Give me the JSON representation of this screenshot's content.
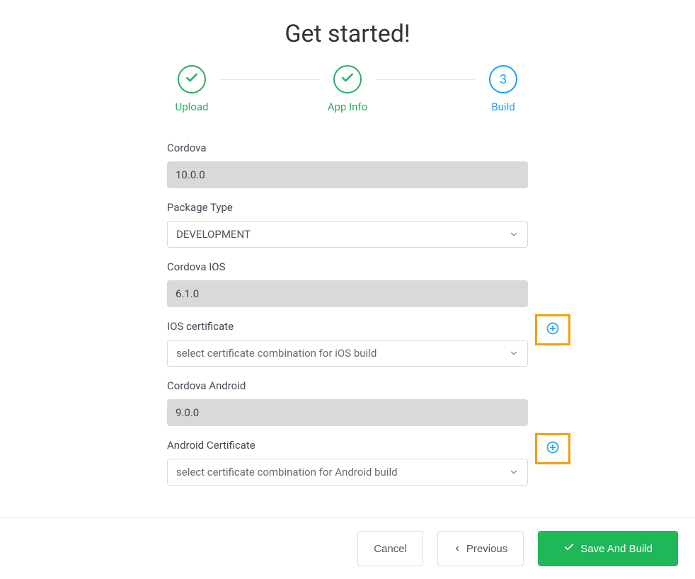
{
  "title": "Get started!",
  "steps": [
    {
      "label": "Upload",
      "state": "done"
    },
    {
      "label": "App Info",
      "state": "done"
    },
    {
      "label": "Build",
      "state": "active",
      "number": "3"
    }
  ],
  "form": {
    "cordova": {
      "label": "Cordova",
      "value": "10.0.0"
    },
    "package_type": {
      "label": "Package Type",
      "value": "DEVELOPMENT"
    },
    "cordova_ios": {
      "label": "Cordova IOS",
      "value": "6.1.0"
    },
    "ios_cert": {
      "label": "IOS certificate",
      "placeholder": "select certificate combination for iOS build"
    },
    "cordova_android": {
      "label": "Cordova Android",
      "value": "9.0.0"
    },
    "android_cert": {
      "label": "Android Certificate",
      "placeholder": "select certificate combination for Android build"
    }
  },
  "footer": {
    "cancel": "Cancel",
    "previous": "Previous",
    "save_build": "Save And Build"
  },
  "colors": {
    "green": "#27ae60",
    "blue": "#1e9ff2",
    "orange_highlight": "#f59e0b",
    "primary_btn": "#1fb758"
  }
}
